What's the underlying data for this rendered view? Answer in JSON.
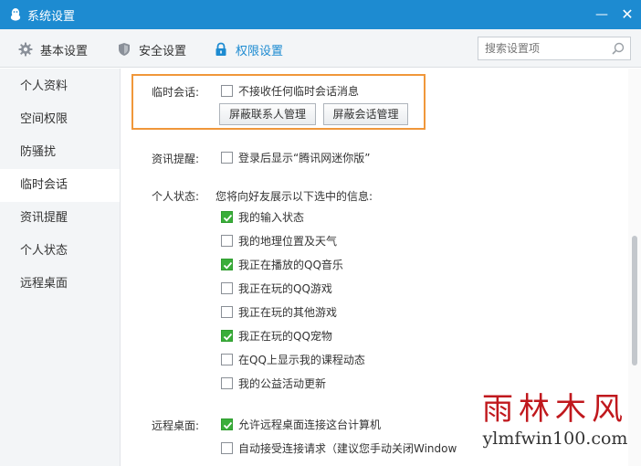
{
  "window": {
    "title": "系统设置",
    "min_label": "—",
    "close_label": "✕"
  },
  "tabs": [
    {
      "label": "基本设置",
      "icon": "gear-icon"
    },
    {
      "label": "安全设置",
      "icon": "shield-icon"
    },
    {
      "label": "权限设置",
      "icon": "lock-icon",
      "active": true
    }
  ],
  "search": {
    "placeholder": "搜索设置项"
  },
  "sidebar": {
    "items": [
      {
        "label": "个人资料"
      },
      {
        "label": "空间权限"
      },
      {
        "label": "防骚扰"
      },
      {
        "label": "临时会话",
        "active": true
      },
      {
        "label": "资讯提醒"
      },
      {
        "label": "个人状态"
      },
      {
        "label": "远程桌面"
      }
    ]
  },
  "temp_chat": {
    "label": "临时会话:",
    "option": {
      "text": "不接收任何临时会话消息",
      "checked": false
    },
    "btn_contacts": "屏蔽联系人管理",
    "btn_sessions": "屏蔽会话管理"
  },
  "news": {
    "label": "资讯提醒:",
    "option": {
      "text": "登录后显示“腾讯网迷你版”",
      "checked": false
    }
  },
  "status": {
    "label": "个人状态:",
    "desc": "您将向好友展示以下选中的信息:",
    "options": [
      {
        "text": "我的输入状态",
        "checked": true
      },
      {
        "text": "我的地理位置及天气",
        "checked": false
      },
      {
        "text": "我正在播放的QQ音乐",
        "checked": true
      },
      {
        "text": "我正在玩的QQ游戏",
        "checked": false
      },
      {
        "text": "我正在玩的其他游戏",
        "checked": false
      },
      {
        "text": "我正在玩的QQ宠物",
        "checked": true
      },
      {
        "text": "在QQ上显示我的课程动态",
        "checked": false
      },
      {
        "text": "我的公益活动更新",
        "checked": false
      }
    ]
  },
  "remote": {
    "label": "远程桌面:",
    "options": [
      {
        "text": "允许远程桌面连接这台计算机",
        "checked": true
      },
      {
        "text": "自动接受连接请求（建议您手动关闭Windows",
        "checked": false
      }
    ]
  },
  "watermark": {
    "line1": "雨林木风",
    "line2": "ylmfwin100.com"
  },
  "colors": {
    "titlebar": "#1d8bd1",
    "accent": "#1d8bd1",
    "highlight": "#f0973a",
    "check": "#3aae3a",
    "watermark": "#c0181d"
  }
}
